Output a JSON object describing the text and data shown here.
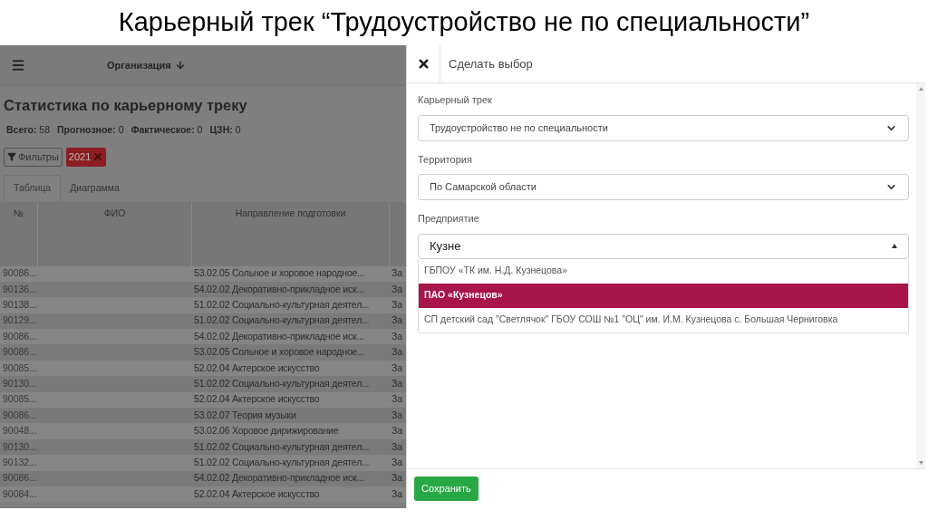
{
  "slide_title": "Карьерный трек “Трудоустройство не по специальности”",
  "app": {
    "top_bar": {
      "organization": "Организация"
    },
    "page_title": "Статистика по карьерному треку",
    "stats": [
      {
        "label": "Всего:",
        "value": "58"
      },
      {
        "label": "Прогнозное:",
        "value": "0"
      },
      {
        "label": "Фактическое:",
        "value": "0"
      },
      {
        "label": "ЦЗН:",
        "value": "0"
      }
    ],
    "filters_button": "Фильтры",
    "filter_chips": [
      "2021"
    ],
    "tabs": [
      {
        "label": "Таблица",
        "selected": true
      },
      {
        "label": "Диаграмма",
        "selected": false
      }
    ],
    "table": {
      "columns": [
        "№",
        "ФИО",
        "Направление подготовки"
      ],
      "rows": [
        {
          "number": "90086...",
          "direction": "53.02.05 Сольное и хоровое народное...",
          "column_4": "За"
        },
        {
          "number": "90136...",
          "direction": "54.02.02 Декоративно-прикладное иск...",
          "column_4": "За"
        },
        {
          "number": "90138...",
          "direction": "51.02.02 Социально-культурная деятел...",
          "column_4": "За"
        },
        {
          "number": "90129...",
          "direction": "51.02.02 Социально-культурная деятел...",
          "column_4": "За"
        },
        {
          "number": "90086...",
          "direction": "54.02.02 Декоративно-прикладное иск...",
          "column_4": "За"
        },
        {
          "number": "90086...",
          "direction": "53.02.05 Сольное и хоровое народное...",
          "column_4": "За"
        },
        {
          "number": "90085...",
          "direction": "52.02.04 Актерское искусство",
          "column_4": "За"
        },
        {
          "number": "90130...",
          "direction": "51.02.02 Социально-культурная деятел...",
          "column_4": "За"
        },
        {
          "number": "90085...",
          "direction": "52.02.04 Актерское искусство",
          "column_4": "За"
        },
        {
          "number": "90086...",
          "direction": "53.02.07 Теория музыки",
          "column_4": "За"
        },
        {
          "number": "90048...",
          "direction": "53.02.06 Хоровое дирижирование",
          "column_4": "За"
        },
        {
          "number": "90130...",
          "direction": "51.02.02 Социально-культурная деятел...",
          "column_4": "За"
        },
        {
          "number": "90132...",
          "direction": "51.02.02 Социально-культурная деятел...",
          "column_4": "За"
        },
        {
          "number": "90086...",
          "direction": "54.02.02 Декоративно-прикладное иск...",
          "column_4": "За"
        },
        {
          "number": "90084...",
          "direction": "52.02.04 Актерское искусство",
          "column_4": "За"
        }
      ]
    }
  },
  "panel": {
    "title": "Сделать выбор",
    "fields": [
      {
        "kind": "select",
        "label": "Карьерный трек",
        "value": "Трудоустройство не по специальности"
      },
      {
        "kind": "select",
        "label": "Территория",
        "value": "По Самарской области"
      },
      {
        "kind": "combobox",
        "label": "Предприятие",
        "value": "Кузне",
        "expanded": true,
        "options": [
          {
            "label": "ГБПОУ «ТК им. Н.Д. Кузнецова»",
            "selected": false
          },
          {
            "label": "ПАО «Кузнецов»",
            "selected": true
          },
          {
            "label": "СП детский сад \"Светлячок\" ГБОУ СОШ №1 \"ОЦ\" им. И.М. Кузнецова с. Большая Черниговка",
            "selected": false
          }
        ]
      }
    ],
    "save_button": "Сохранить"
  }
}
